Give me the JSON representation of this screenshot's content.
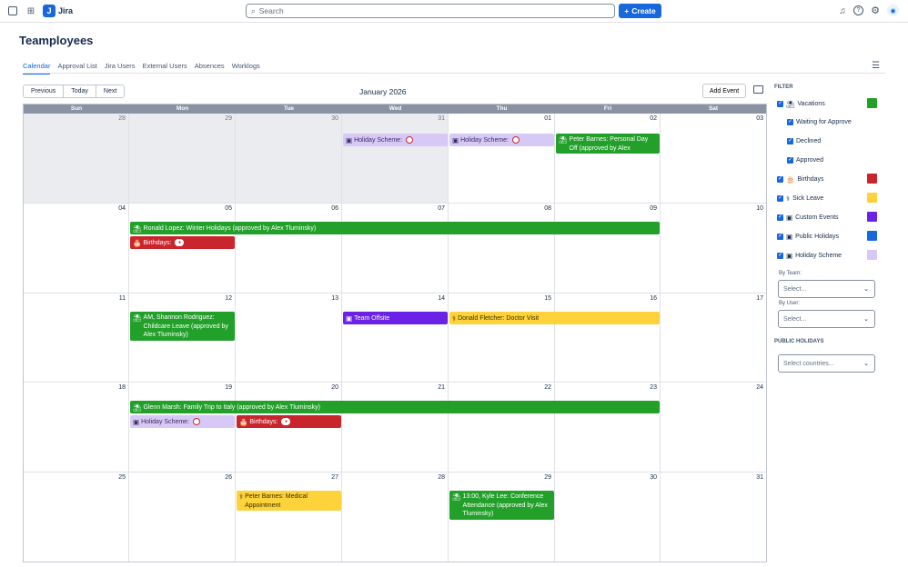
{
  "app": {
    "name": "Jira",
    "logo_letter": "J"
  },
  "search": {
    "placeholder": "Search"
  },
  "create_label": "Create",
  "page_title": "Teamployees",
  "tabs": [
    "Calendar",
    "Approval List",
    "Jira Users",
    "External Users",
    "Absences",
    "Worklogs"
  ],
  "nav": {
    "previous": "Previous",
    "today": "Today",
    "next": "Next"
  },
  "month_label": "January 2026",
  "add_event": "Add Event",
  "days_of_week": [
    "Sun",
    "Mon",
    "Tue",
    "Wed",
    "Thu",
    "Fri",
    "Sat"
  ],
  "weeks": [
    [
      "28",
      "29",
      "30",
      "31",
      "01",
      "02",
      "03"
    ],
    [
      "04",
      "05",
      "06",
      "07",
      "08",
      "09",
      "10"
    ],
    [
      "11",
      "12",
      "13",
      "14",
      "15",
      "16",
      "17"
    ],
    [
      "18",
      "19",
      "20",
      "21",
      "22",
      "23",
      "24"
    ],
    [
      "25",
      "26",
      "27",
      "28",
      "29",
      "30",
      "31"
    ]
  ],
  "events": [
    {
      "text": "Holiday Scheme:",
      "type": "holiday-scheme"
    },
    {
      "text": "Holiday Scheme:",
      "type": "holiday-scheme"
    },
    {
      "text": "Peter Barnes: Personal Day Off (approved by Alex Tluminsky)",
      "type": "vacation"
    },
    {
      "text": "Ronald Lopez: Winter Holidays (approved by Alex Tluminsky)",
      "type": "vacation"
    },
    {
      "text": "Birthdays:",
      "type": "birthday"
    },
    {
      "text": "AM, Shannon Rodriguez: Childcare Leave (approved by Alex Tluminsky)",
      "type": "vacation"
    },
    {
      "text": "Team Offsite",
      "type": "custom"
    },
    {
      "text": "Donald Fletcher: Doctor Visit",
      "type": "sick"
    },
    {
      "text": "Glenn Marsh: Family Trip to Italy (approved by Alex Tluminsky)",
      "type": "vacation"
    },
    {
      "text": "Holiday Scheme:",
      "type": "holiday-scheme"
    },
    {
      "text": "Birthdays:",
      "type": "birthday"
    },
    {
      "text": "Peter Barnes: Medical Appointment",
      "type": "sick"
    },
    {
      "text": "13:00, Kyle Lee: Conference Attendance (approved by Alex Tluminsky)",
      "type": "vacation"
    }
  ],
  "filter": {
    "title": "FILTER",
    "items": [
      {
        "label": "Vacations",
        "color": "#22a02a"
      },
      {
        "label": "Waiting for Approve"
      },
      {
        "label": "Declined"
      },
      {
        "label": "Approved"
      },
      {
        "label": "Birthdays",
        "color": "#c9252d"
      },
      {
        "label": "Sick Leave",
        "color": "#fdd23b"
      },
      {
        "label": "Custom Events",
        "color": "#6b22e6"
      },
      {
        "label": "Public Holidays",
        "color": "#1868db"
      },
      {
        "label": "Holiday Scheme",
        "color": "#d7c9f6"
      }
    ],
    "by_team_label": "By Team:",
    "by_team_placeholder": "Select...",
    "by_user_label": "By User:",
    "by_user_placeholder": "Select...",
    "public_holidays_title": "PUBLIC HOLIDAYS",
    "countries_placeholder": "Select countries..."
  }
}
